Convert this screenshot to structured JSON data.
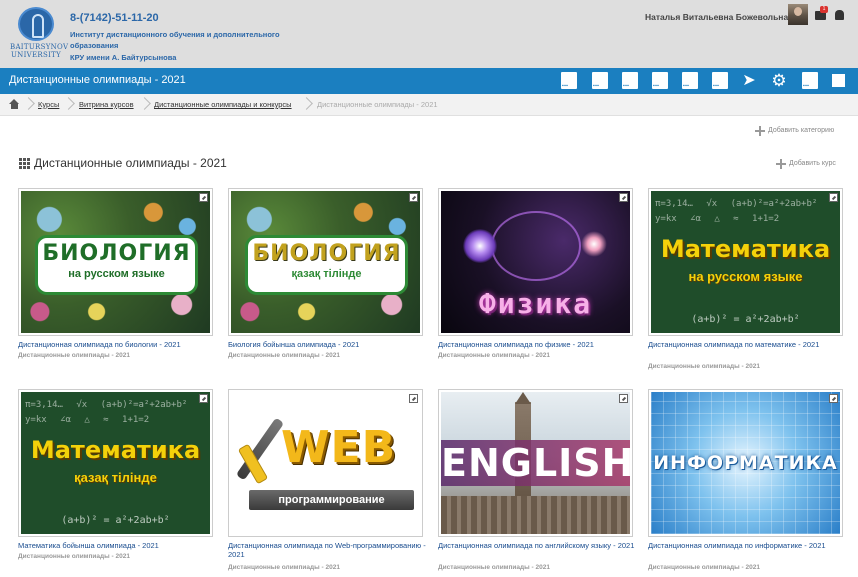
{
  "header": {
    "logo_text": "BAITURSYNOV UNIVERSITY",
    "phone": "8-(7142)-51-11-20",
    "institute": "Институт дистанционного обучения и дополнительного образования",
    "university": "КРУ имени А. Байтурсынова",
    "user_name": "Наталья Витальевна Божевольная",
    "message_count": "1"
  },
  "navbar": {
    "title": "Дистанционные олимпиады - 2021",
    "icons": [
      "document-icon",
      "document-icon",
      "document-icon",
      "document-icon",
      "document-icon",
      "send-icon",
      "gear-icon",
      "document-icon",
      "image-icon"
    ]
  },
  "breadcrumb": {
    "items": [
      "Курсы",
      "Витрина курсов",
      "Дистанционные олимпиады и конкурсы",
      "Дистанционные олимпиады - 2021"
    ]
  },
  "actions": {
    "add_category": "Добавить категорию",
    "add_course": "Добавить курс"
  },
  "category_title": "Дистанционные олимпиады - 2021",
  "courses": [
    {
      "name": "Дистанционная олимпиада по биологии - 2021",
      "category": "Дистанционные олимпиады - 2021",
      "art_title": "БИОЛОГИЯ",
      "art_sub": "на русском языке"
    },
    {
      "name": "Биология бойынша олимпиада - 2021",
      "category": "Дистанционные олимпиады - 2021",
      "art_title": "БИОЛОГИЯ",
      "art_sub": "қазақ тілінде"
    },
    {
      "name": "Дистанционная олимпиада по физике - 2021",
      "category": "Дистанционные олимпиады - 2021",
      "art_title": "Физика"
    },
    {
      "name": "Дистанционная олимпиада по математике - 2021",
      "category": "Дистанционные олимпиады - 2021",
      "art_title": "Математика",
      "art_sub": "на русском языке",
      "art_formula": "(a+b)² = a²+2ab+b²"
    },
    {
      "name": "Математика бойынша олимпиада - 2021",
      "category": "Дистанционные олимпиады - 2021",
      "art_title": "Математика",
      "art_sub": "қазақ тілінде",
      "art_formula": "(a+b)² = a²+2ab+b²"
    },
    {
      "name": "Дистанционная олимпиада по Web-программированию - 2021",
      "category": "Дистанционные олимпиады - 2021",
      "art_title": "WEB",
      "art_sub": "программирование"
    },
    {
      "name": "Дистанционная олимпиада по английскому языку - 2021",
      "category": "Дистанционные олимпиады - 2021",
      "art_title": "ENGLISH"
    },
    {
      "name": "Дистанционная олимпиада по информатике - 2021",
      "category": "Дистанционные олимпиады - 2021",
      "art_title": "ИНФОРМАТИКА"
    }
  ],
  "colors": {
    "header_bg": "#dedede",
    "navbar_bg": "#1b7fc0",
    "brand_blue": "#2b67a8",
    "link": "#1a4d8f"
  }
}
